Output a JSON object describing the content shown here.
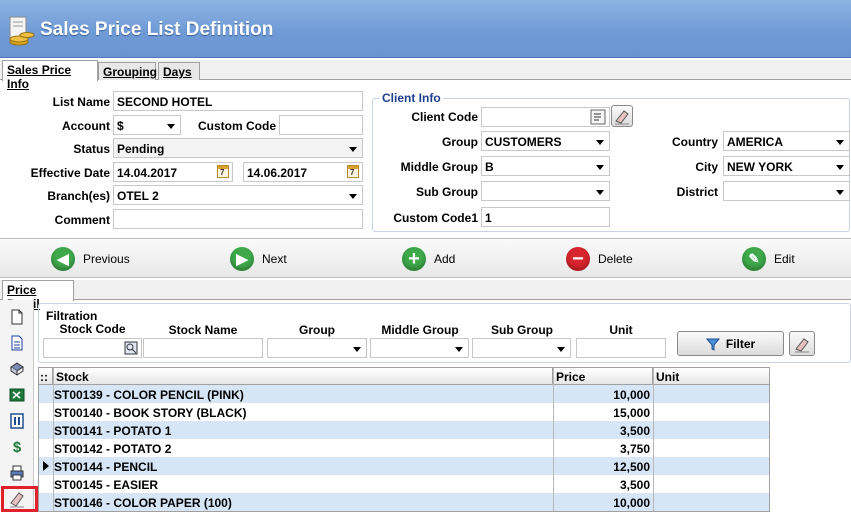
{
  "window": {
    "title": "Sales Price List Definition"
  },
  "tabs": [
    {
      "label": "Sales Price Info"
    },
    {
      "label": "Grouping"
    },
    {
      "label": "Days"
    }
  ],
  "form": {
    "list_name_label": "List Name",
    "list_name": "SECOND HOTEL",
    "account_label": "Account",
    "account": "$",
    "custom_code_label": "Custom Code",
    "custom_code": "",
    "status_label": "Status",
    "status": "Pending",
    "effective_date_label": "Effective Date",
    "date_from": "14.04.2017",
    "date_to": "14.06.2017",
    "branches_label": "Branch(es)",
    "branches": "OTEL 2",
    "comment_label": "Comment",
    "comment": ""
  },
  "client_info": {
    "title": "Client Info",
    "client_code_label": "Client Code",
    "client_code": "",
    "group_label": "Group",
    "group": "CUSTOMERS",
    "middle_group_label": "Middle Group",
    "middle_group": "B",
    "sub_group_label": "Sub Group",
    "sub_group": "",
    "custom_code1_label": "Custom Code1",
    "custom_code1": "1",
    "country_label": "Country",
    "country": "AMERICA",
    "city_label": "City",
    "city": "NEW YORK",
    "district_label": "District",
    "district": ""
  },
  "nav": {
    "previous": "Previous",
    "next": "Next",
    "add": "Add",
    "delete": "Delete",
    "edit": "Edit"
  },
  "price_detail_tab": "Price Detail",
  "filtration": {
    "title": "Filtration",
    "stock_code": "Stock Code",
    "stock_name": "Stock Name",
    "group": "Group",
    "middle_group": "Middle Group",
    "sub_group": "Sub Group",
    "unit": "Unit",
    "filter_button": "Filter"
  },
  "grid": {
    "columns": [
      "::",
      "Stock",
      "Price",
      "Unit"
    ],
    "rows": [
      {
        "stock": "ST00139 - COLOR PENCIL (PINK)",
        "price": "10,000",
        "unit": ""
      },
      {
        "stock": "ST00140 - BOOK STORY (BLACK)",
        "price": "15,000",
        "unit": ""
      },
      {
        "stock": "ST00141 - POTATO 1",
        "price": "3,500",
        "unit": ""
      },
      {
        "stock": "ST00142 - POTATO 2",
        "price": "3,750",
        "unit": ""
      },
      {
        "stock": "ST00144 - PENCIL",
        "price": "12,500",
        "unit": ""
      },
      {
        "stock": "ST00145 - EASIER",
        "price": "3,500",
        "unit": ""
      },
      {
        "stock": "ST00146 - COLOR PAPER (100)",
        "price": "10,000",
        "unit": ""
      }
    ]
  },
  "sidebar_icons": [
    "new-document-icon",
    "document-list-icon",
    "book-icon",
    "excel-icon",
    "calculator-icon",
    "dollar-icon",
    "print-icon",
    "eraser-icon"
  ],
  "colors": {
    "header_blue": "#6f9bd6",
    "row_alt": "#d6e6f7",
    "highlight_red": "#e0202a"
  }
}
